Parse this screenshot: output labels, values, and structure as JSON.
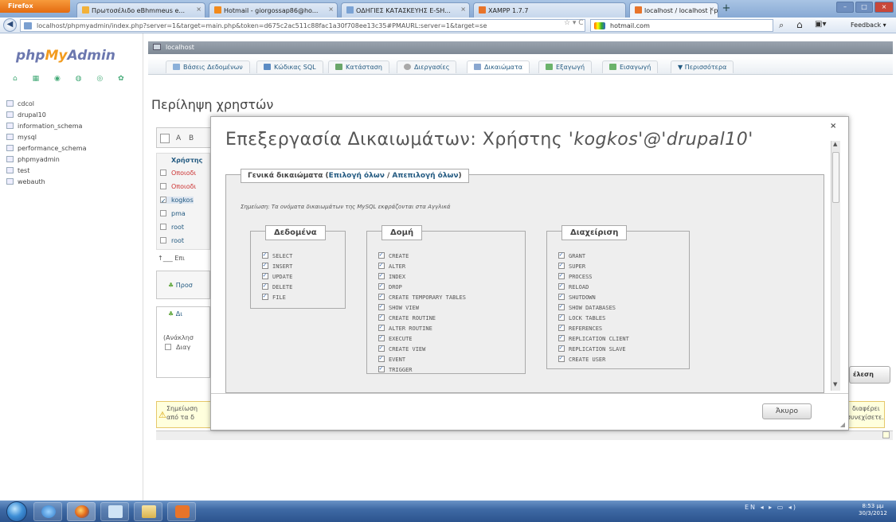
{
  "browser": {
    "app_button": "Firefox",
    "tabs": [
      {
        "label": "Πρωτοσέλιδο eΒhmmeus e..."
      },
      {
        "label": "Hotmail - giorgossap86@ho..."
      },
      {
        "label": "ΟΔΗΓΙΕΣ ΚΑΤΑΣΚΕΥΗΣ E-SH..."
      },
      {
        "label": "XAMPP 1.7.7"
      },
      {
        "label": "localhost / localhost | phpM..."
      }
    ],
    "url": "localhost/phpmyadmin/index.php?server=1&target=main.php&token=d675c2ac511c88fac1a30f708ee13c35#PMAURL:server=1&target=se",
    "search_engine_text": "hotmail.com",
    "feedback": "Feedback"
  },
  "pma": {
    "logo_php": "php",
    "logo_my": "My",
    "logo_admin": "Admin",
    "databases": [
      "cdcol",
      "drupal10",
      "information_schema",
      "mysql",
      "performance_schema",
      "phpmyadmin",
      "test",
      "webauth"
    ],
    "server_label": "localhost",
    "menu": [
      {
        "label": "Βάσεις Δεδομένων",
        "color": "#8bb0d9"
      },
      {
        "label": "Κώδικας SQL",
        "color": "#5c8cc4"
      },
      {
        "label": "Κατάσταση",
        "color": "#6aa66a"
      },
      {
        "label": "Διεργασίες",
        "color": "#a9a9a9"
      },
      {
        "label": "Δικαιώματα",
        "color": "#8aa7d0"
      },
      {
        "label": "Εξαγωγή",
        "color": "#6bb36b"
      },
      {
        "label": "Εισαγωγή",
        "color": "#6bb36b"
      },
      {
        "label": "Περισσότερα",
        "color": ""
      }
    ],
    "page_title": "Περίληψη χρηστών",
    "bg": {
      "header_a": "A",
      "header_b": "B",
      "col_user": "Χρήστης",
      "users": [
        "Οποιοδι",
        "Οποιοδι",
        "kogkos",
        "pma",
        "root",
        "root"
      ],
      "with_selected": "Επι",
      "add_user": "Προσ",
      "tab2": "Δι",
      "reload": "(Ανάκλησ",
      "delete": "Διαγ",
      "go_btn": "έλεση",
      "warn_left_1": "Σημείωση",
      "warn_left_2": "από τα δ",
      "warn_right_1": "διαφέρει",
      "warn_right_2": "συνεχίσετε."
    }
  },
  "modal": {
    "title_prefix": "Επεξεργασία Δικαιωμάτων: Χρήστης ",
    "title_user": "'kogkos'@'drupal10'",
    "close": "×",
    "legend_label": "Γενικά δικαιώματα",
    "legend_select_all": "Επιλογή όλων",
    "legend_sep": "/",
    "legend_deselect_all": "Απεπιλογή όλων",
    "note": "Σημείωση: Τα ονόματα δικαιωμάτων της MySQL εκφράζονται στα Αγγλικά",
    "groups": [
      {
        "title": "Δεδομένα",
        "privs": [
          "SELECT",
          "INSERT",
          "UPDATE",
          "DELETE",
          "FILE"
        ]
      },
      {
        "title": "Δομή",
        "privs": [
          "CREATE",
          "ALTER",
          "INDEX",
          "DROP",
          "CREATE TEMPORARY TABLES",
          "SHOW VIEW",
          "CREATE ROUTINE",
          "ALTER ROUTINE",
          "EXECUTE",
          "CREATE VIEW",
          "EVENT",
          "TRIGGER"
        ]
      },
      {
        "title": "Διαχείριση",
        "privs": [
          "GRANT",
          "SUPER",
          "PROCESS",
          "RELOAD",
          "SHUTDOWN",
          "SHOW DATABASES",
          "LOCK TABLES",
          "REFERENCES",
          "REPLICATION CLIENT",
          "REPLICATION SLAVE",
          "CREATE USER"
        ]
      }
    ],
    "cancel": "Άκυρο"
  },
  "taskbar": {
    "tray": "EN",
    "time": "8:53 μμ",
    "date": "30/3/2012"
  }
}
